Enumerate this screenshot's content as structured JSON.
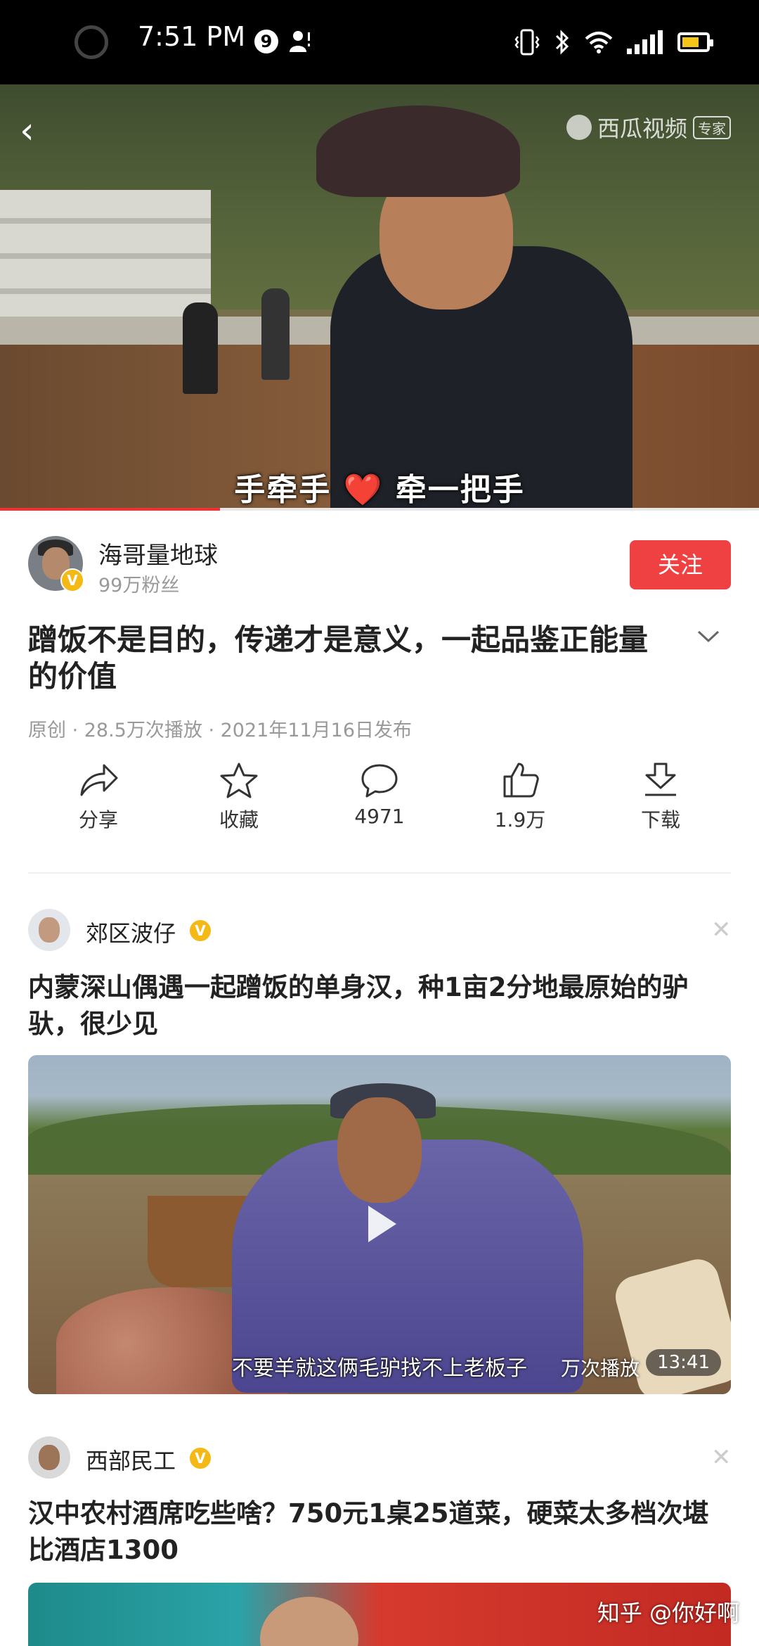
{
  "status_bar": {
    "time": "7:51 PM",
    "notification_count": "9"
  },
  "video": {
    "subtitle": "手牵手 ❤️ 牵一把手",
    "logo_text": "西瓜视频",
    "logo_tag": "专家",
    "progress": 0.29
  },
  "author": {
    "name": "海哥量地球",
    "fans": "99万粉丝",
    "follow_label": "关注"
  },
  "video_info": {
    "title": "蹭饭不是目的，传递才是意义，一起品鉴正能量的价值",
    "meta": "原创 · 28.5万次播放 · 2021年11月16日发布"
  },
  "actions": [
    {
      "label": "分享",
      "icon": "share-icon"
    },
    {
      "label": "收藏",
      "icon": "star-icon"
    },
    {
      "label": "4971",
      "icon": "comment-icon"
    },
    {
      "label": "1.9万",
      "icon": "like-icon"
    },
    {
      "label": "下载",
      "icon": "download-icon"
    }
  ],
  "feed": [
    {
      "author": "郊区波仔",
      "title": "内蒙深山偶遇一起蹭饭的单身汉，种1亩2分地最原始的驴驮，很少见",
      "caption": "不要羊就这俩毛驴找不上老板子",
      "plays": "万次播放",
      "duration": "13:41"
    },
    {
      "author": "西部民工",
      "title": "汉中农村酒席吃些啥？750元1桌25道菜，硬菜太多档次堪比酒店1300"
    }
  ],
  "watermark": "知乎 @你好啊",
  "colors": {
    "accent_red": "#f04142",
    "verified_badge": "#f5b915"
  }
}
